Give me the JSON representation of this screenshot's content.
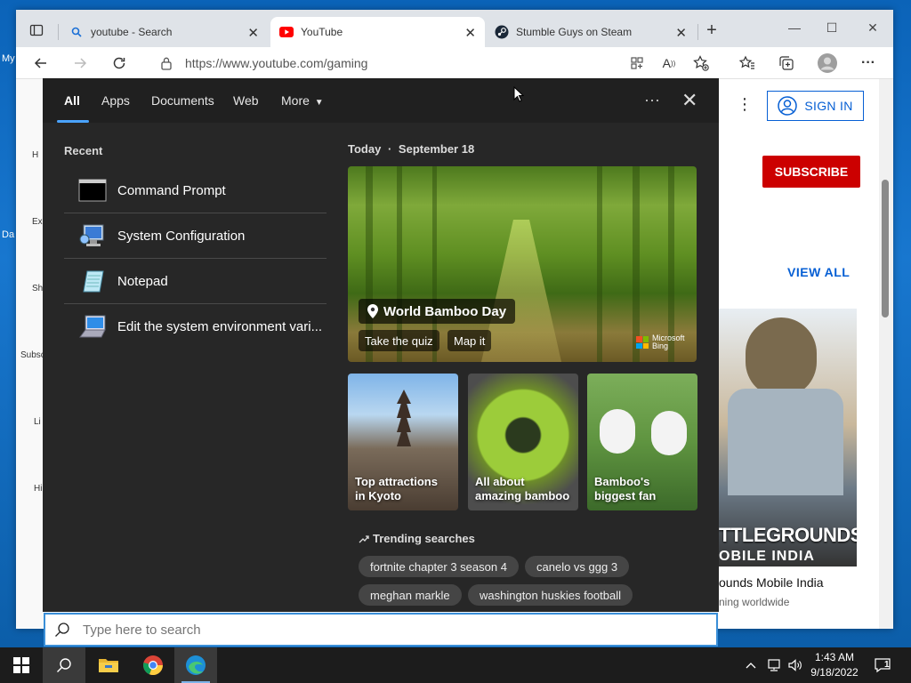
{
  "desktop": {
    "labels": [
      "My",
      "Da"
    ]
  },
  "browser": {
    "tabs": [
      {
        "title": "youtube - Search"
      },
      {
        "title": "YouTube"
      },
      {
        "title": "Stumble Guys on Steam"
      }
    ],
    "url": "https://www.youtube.com/gaming"
  },
  "youtube": {
    "sign_in": "SIGN IN",
    "subscribe": "SUBSCRIBE",
    "view_all": "VIEW ALL",
    "game_art_line1": "TTLEGROUNDS",
    "game_art_line2": "OBILE INDIA",
    "game_caption": "ounds Mobile India",
    "game_sub": "ning worldwide",
    "left_nav": [
      "H",
      "Ex",
      "Sh",
      "Subsc",
      "Li",
      "Hi"
    ]
  },
  "search_panel": {
    "tabs": [
      "All",
      "Apps",
      "Documents",
      "Web",
      "More"
    ],
    "recent_title": "Recent",
    "recent": [
      {
        "label": "Command Prompt",
        "icon": "command-prompt-icon"
      },
      {
        "label": "System Configuration",
        "icon": "system-configuration-icon"
      },
      {
        "label": "Notepad",
        "icon": "notepad-icon"
      },
      {
        "label": "Edit the system environment vari...",
        "icon": "system-environment-icon"
      }
    ],
    "today_label": "Today",
    "today_date": "September 18",
    "hero": {
      "title": "World Bamboo Day",
      "button1": "Take the quiz",
      "button2": "Map it",
      "brand_line1": "Microsoft",
      "brand_line2": "Bing"
    },
    "cards": [
      {
        "label": "Top attractions in Kyoto"
      },
      {
        "label": "All about amazing bamboo"
      },
      {
        "label": "Bamboo's biggest fan"
      }
    ],
    "trending_title": "Trending searches",
    "trending": [
      "fortnite chapter 3 season 4",
      "canelo vs ggg 3",
      "meghan markle",
      "washington huskies football"
    ],
    "search_placeholder": "Type here to search"
  },
  "taskbar": {
    "time": "1:43 AM",
    "date": "9/18/2022",
    "notifications": "1"
  },
  "colors": {
    "accent": "#4aa3ff",
    "youtube_red": "#cc0000",
    "youtube_blue": "#065fd4"
  }
}
